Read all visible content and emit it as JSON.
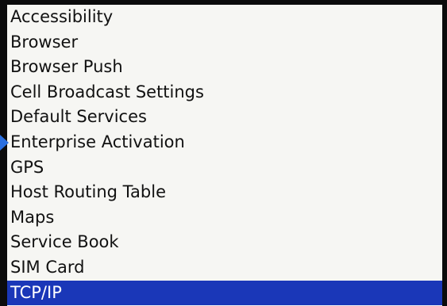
{
  "menu": {
    "items": [
      {
        "label": "Accessibility"
      },
      {
        "label": "Browser"
      },
      {
        "label": "Browser Push"
      },
      {
        "label": "Cell Broadcast Settings"
      },
      {
        "label": "Default Services"
      },
      {
        "label": "Enterprise Activation"
      },
      {
        "label": "GPS"
      },
      {
        "label": "Host Routing Table"
      },
      {
        "label": "Maps"
      },
      {
        "label": "Service Book"
      },
      {
        "label": "SIM Card"
      },
      {
        "label": "TCP/IP"
      }
    ],
    "selected_label": "TCP/IP"
  },
  "colors": {
    "selection_background": "#1a37b8",
    "selection_text": "#ffffff",
    "list_background": "#f6f6f3",
    "item_text": "#111111",
    "focus_marker": "#2a6fe0"
  },
  "icons": {
    "focus_marker": "focus-arrow-icon"
  }
}
